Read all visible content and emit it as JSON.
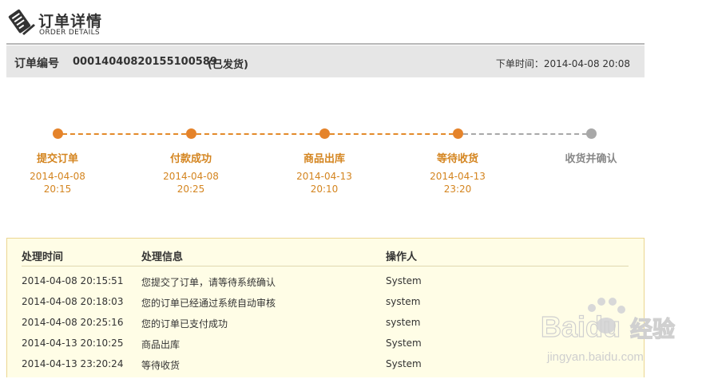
{
  "header": {
    "title_cn": "订单详情",
    "title_en": "ORDER DETAILS"
  },
  "order": {
    "label": "订单编号",
    "number": "00014040820155100589",
    "status": "(已发货)",
    "time_label": "下单时间：",
    "time_value": "2014-04-08 20:08"
  },
  "progress": {
    "active_color": "#e5832a",
    "inactive_color": "#a8a8a8",
    "steps": [
      {
        "label": "提交订单",
        "date": "2014-04-08",
        "time": "20:15",
        "done": true
      },
      {
        "label": "付款成功",
        "date": "2014-04-08",
        "time": "20:25",
        "done": true
      },
      {
        "label": "商品出库",
        "date": "2014-04-13",
        "time": "20:10",
        "done": true
      },
      {
        "label": "等待收货",
        "date": "2014-04-13",
        "time": "23:20",
        "done": true
      },
      {
        "label": "收货并确认",
        "date": "",
        "time": "",
        "done": false
      }
    ]
  },
  "log": {
    "columns": [
      "处理时间",
      "处理信息",
      "操作人"
    ],
    "rows": [
      [
        "2014-04-08 20:15:51",
        "您提交了订单，请等待系统确认",
        "System"
      ],
      [
        "2014-04-08 20:18:03",
        "您的订单已经通过系统自动审核",
        "system"
      ],
      [
        "2014-04-08 20:25:16",
        "您的订单已支付成功",
        "system"
      ],
      [
        "2014-04-13 20:10:25",
        "商品出库",
        "System"
      ],
      [
        "2014-04-13 23:20:24",
        "等待收货",
        "System"
      ]
    ]
  },
  "watermark": {
    "brand": "Baidu",
    "brand_cn": "经验",
    "site": "jingyan.baidu.com",
    "icon": "paw-icon"
  }
}
